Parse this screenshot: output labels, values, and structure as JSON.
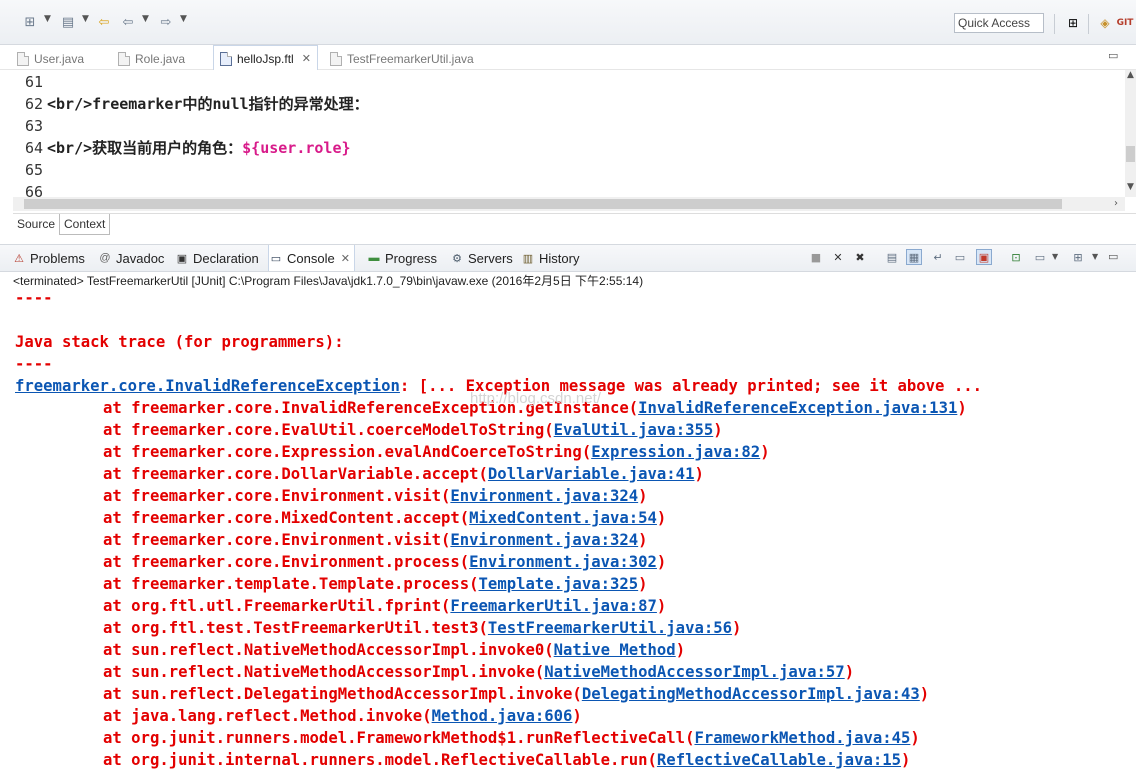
{
  "toolbar": {
    "quick_access_placeholder": "Quick Access",
    "icons": [
      "new-icon",
      "save-icon",
      "back-icon",
      "forward-icon"
    ]
  },
  "editor_tabs": [
    {
      "label": "User.java",
      "active": false
    },
    {
      "label": "Role.java",
      "active": false
    },
    {
      "label": "helloJsp.ftl",
      "active": true
    },
    {
      "label": "TestFreemarkerUtil.java",
      "active": false
    }
  ],
  "code": {
    "lines": [
      {
        "num": "61",
        "text": "",
        "var": ""
      },
      {
        "num": "62",
        "text": "<br/>freemarker中的null指针的异常处理：",
        "var": ""
      },
      {
        "num": "63",
        "text": "",
        "var": ""
      },
      {
        "num": "64",
        "text": "<br/>获取当前用户的角色：",
        "var": "${user.role}"
      },
      {
        "num": "65",
        "text": "",
        "var": ""
      },
      {
        "num": "66",
        "text": "",
        "var": ""
      }
    ]
  },
  "source_tabs": [
    "Source",
    "Context"
  ],
  "view_tabs": [
    "Problems",
    "Javadoc",
    "Declaration",
    "Console",
    "Progress",
    "Servers",
    "History"
  ],
  "console": {
    "terminated_line": "<terminated> TestFreemarkerUtil [JUnit] C:\\Program Files\\Java\\jdk1.7.0_79\\bin\\javaw.exe (2016年2月5日 下午2:55:14)",
    "dashes": "----",
    "heading": "Java stack trace (for programmers):",
    "exception_class": "freemarker.core.InvalidReferenceException",
    "exception_msg": ": [... Exception message was already printed; see it above ...",
    "frames": [
      {
        "method": "at freemarker.core.InvalidReferenceException.getInstance",
        "loc": "InvalidReferenceException.java:131"
      },
      {
        "method": "at freemarker.core.EvalUtil.coerceModelToString",
        "loc": "EvalUtil.java:355"
      },
      {
        "method": "at freemarker.core.Expression.evalAndCoerceToString",
        "loc": "Expression.java:82"
      },
      {
        "method": "at freemarker.core.DollarVariable.accept",
        "loc": "DollarVariable.java:41"
      },
      {
        "method": "at freemarker.core.Environment.visit",
        "loc": "Environment.java:324"
      },
      {
        "method": "at freemarker.core.MixedContent.accept",
        "loc": "MixedContent.java:54"
      },
      {
        "method": "at freemarker.core.Environment.visit",
        "loc": "Environment.java:324"
      },
      {
        "method": "at freemarker.core.Environment.process",
        "loc": "Environment.java:302"
      },
      {
        "method": "at freemarker.template.Template.process",
        "loc": "Template.java:325"
      },
      {
        "method": "at org.ftl.utl.FreemarkerUtil.fprint",
        "loc": "FreemarkerUtil.java:87"
      },
      {
        "method": "at org.ftl.test.TestFreemarkerUtil.test3",
        "loc": "TestFreemarkerUtil.java:56"
      },
      {
        "method": "at sun.reflect.NativeMethodAccessorImpl.invoke0",
        "loc": "Native Method"
      },
      {
        "method": "at sun.reflect.NativeMethodAccessorImpl.invoke",
        "loc": "NativeMethodAccessorImpl.java:57"
      },
      {
        "method": "at sun.reflect.DelegatingMethodAccessorImpl.invoke",
        "loc": "DelegatingMethodAccessorImpl.java:43"
      },
      {
        "method": "at java.lang.reflect.Method.invoke",
        "loc": "Method.java:606"
      },
      {
        "method": "at org.junit.runners.model.FrameworkMethod$1.runReflectiveCall",
        "loc": "FrameworkMethod.java:45"
      },
      {
        "method": "at org.junit.internal.runners.model.ReflectiveCallable.run",
        "loc": "ReflectiveCallable.java:15"
      }
    ],
    "watermark": "http://blog.csdn.net/"
  },
  "colors": {
    "error_red": "#e30000",
    "link_blue": "#0b56b3",
    "ftl_var": "#d81b8a"
  }
}
